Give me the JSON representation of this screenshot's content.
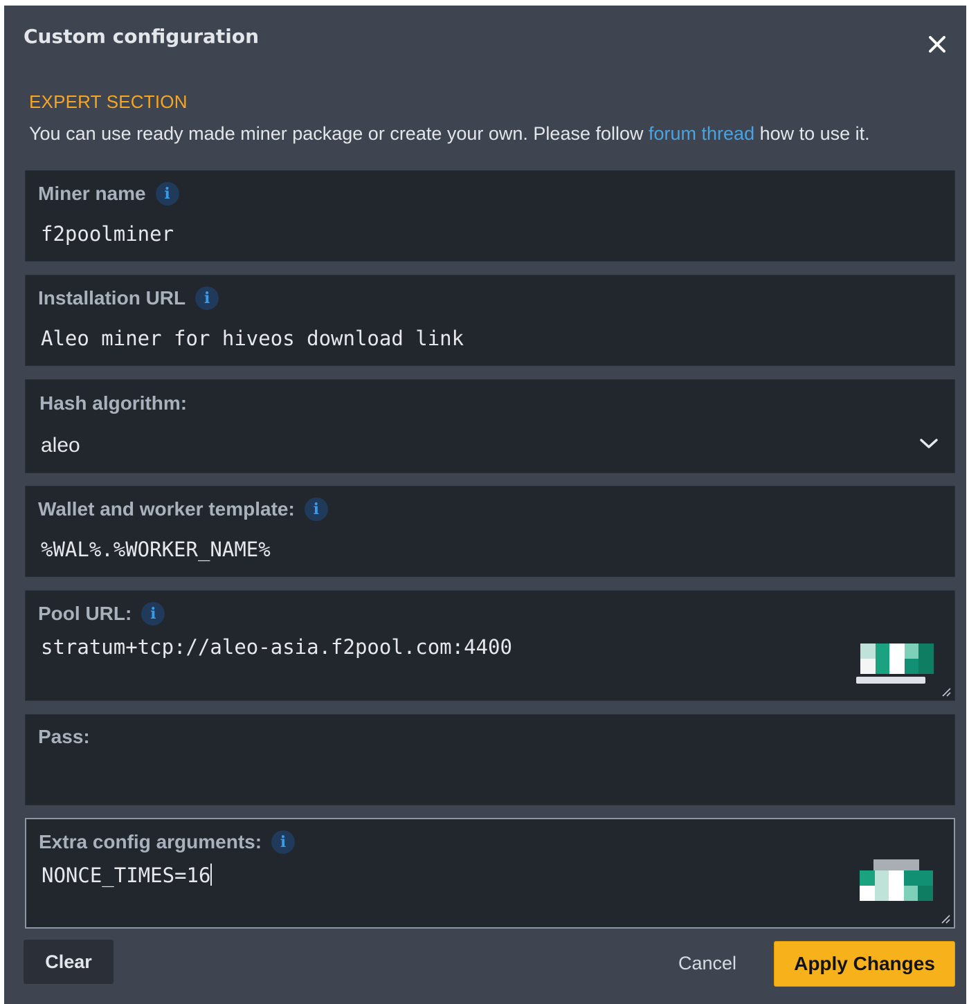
{
  "dialog": {
    "title": "Custom configuration",
    "close_icon": "close-icon"
  },
  "expert": {
    "label": "EXPERT SECTION",
    "desc_before": "You can use ready made miner package or create your own. Please follow ",
    "link_text": "forum thread",
    "desc_after": " how to use it."
  },
  "fields": {
    "miner_name": {
      "label": "Miner name",
      "value": "f2poolminer"
    },
    "install_url": {
      "label": "Installation URL",
      "value": "Aleo miner for hiveos download link"
    },
    "hash_algo": {
      "label": "Hash algorithm:",
      "value": "aleo"
    },
    "wallet_template": {
      "label": "Wallet and worker template:",
      "value": "%WAL%.%WORKER_NAME%"
    },
    "pool_url": {
      "label": "Pool URL:",
      "value": "stratum+tcp://aleo-asia.f2pool.com:4400"
    },
    "pass": {
      "label": "Pass:",
      "value": ""
    },
    "extra_args": {
      "label": "Extra config arguments:",
      "value": "NONCE_TIMES=16"
    }
  },
  "buttons": {
    "clear": "Clear",
    "cancel": "Cancel",
    "apply": "Apply Changes"
  },
  "colors": {
    "accent_orange": "#f5a623",
    "link_blue": "#4aa3e0",
    "apply_yellow": "#f7b21b",
    "modal_bg": "#3e4450",
    "field_bg": "#22262d"
  }
}
